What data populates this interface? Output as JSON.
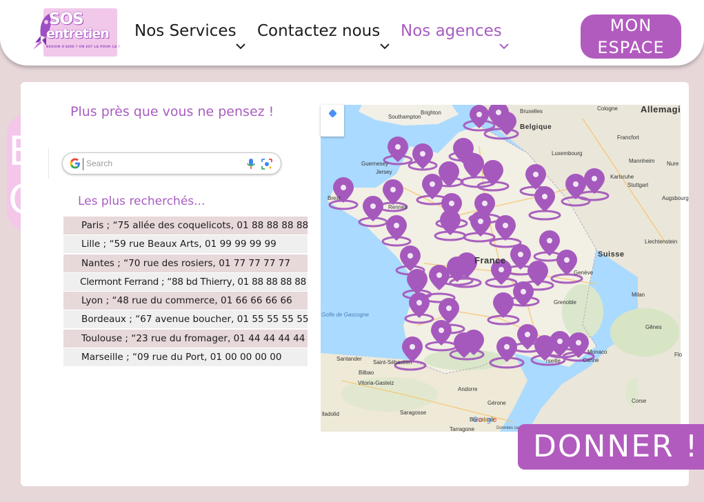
{
  "header": {
    "logo": {
      "line1": "SOS",
      "line2": "entretien",
      "tagline": "BESOIN D'AIDE ? ON EST LÀ POUR ÇA !"
    },
    "nav": [
      {
        "label": "Nos Services",
        "active": false
      },
      {
        "label": "Contactez nous",
        "active": false
      },
      {
        "label": "Nos agences",
        "active": true
      }
    ],
    "account_button": {
      "line1": "MON",
      "line2": "ESPACE"
    }
  },
  "decor": {
    "letter1": "E",
    "letter2": "C"
  },
  "main": {
    "tagline": "Plus près que vous ne pensez !",
    "search": {
      "placeholder": "Search"
    },
    "most_searched_title": "Les plus recherchés...",
    "agencies": [
      "Paris ; “75 allée des coquelicots, 01 88 88 88 88",
      "Lille ; “59 rue Beaux Arts, 01 99 99 99 99",
      "Nantes ; “70 rue des rosiers, 01 77 77 77 77",
      "Clermont Ferrand ; “88 bd Thierry, 01 88 88 88 88",
      "Lyon ; “48 rue du commerce, 01 66 66 66 66",
      "Bordeaux ; “67 avenue boucher, 01 55 55 55 55",
      "Toulouse ; “23 rue du fromager, 01 44 44 44 44",
      "Marseille ; “09 rue du Port, 01 00 00 00 00"
    ]
  },
  "map": {
    "labels": {
      "allemagne": "Allemagi",
      "belgique": "Belgique",
      "france": "France",
      "suisse": "Suisse",
      "luxembourg": "Luxembourg",
      "liechtenstein": "Liechtenstein",
      "andorre": "Andorre",
      "monaco": "Monaco",
      "bruxelles": "Bruxelles",
      "cologne": "Cologne",
      "frankfurt": "Francfort",
      "stuttgart": "Stuttgart",
      "milan": "Milan",
      "genes": "Gênes",
      "grenoble": "Grenoble",
      "brest": "Brest",
      "rennes": "Rennes",
      "bilbao": "Bilbao",
      "saragosse": "Saragosse",
      "barcelone": "Barcelone",
      "corse": "Corse",
      "golfe": "Golfe de Gascogne",
      "jersey": "Jersey",
      "guernesey": "Guernesey",
      "southampton": "Southampton",
      "brighton": "Brighton",
      "santander": "Santander",
      "gerone": "Gérone",
      "tarragone": "Tarragone",
      "vitoria": "Vitoria-Gasteiz",
      "valladolid": "lladolid",
      "karlsruhe": "Karlsruhe",
      "mannheim": "Mannheim",
      "augsburg": "Augsbourg",
      "nuremberg": "Nure",
      "geneve": "Genève",
      "cannes": "Canne",
      "marseille": "rseille",
      "saint_sebastien": "Saint-Sébastien",
      "flo": "Flo"
    },
    "attribution": {
      "google": "Google",
      "data": "Données carto"
    },
    "pin_color": "#a559bd"
  },
  "donate_button": "DONNER !",
  "colors": {
    "accent": "#b25bbf",
    "text_accent": "#a85cc0",
    "background": "#e7d7d9",
    "row_odd": "#e7d8da",
    "row_even": "#efefef"
  }
}
